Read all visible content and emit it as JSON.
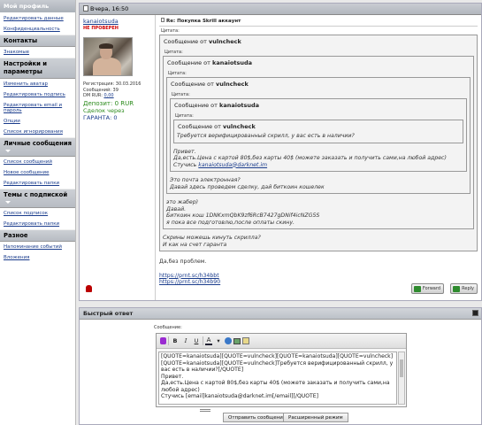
{
  "sidebar": {
    "top": "Мой профиль",
    "sections": [
      {
        "links": [
          "Редактировать данные",
          "Конфиденциальность"
        ]
      },
      {
        "title": "Контакты",
        "links": [
          "Знакомые"
        ]
      },
      {
        "title": "Настройки и параметры",
        "links": [
          "Изменить аватар",
          "Редактировать подпись",
          "Редактировать email и пароль",
          "Опции",
          "Список игнорирования"
        ]
      },
      {
        "title": "Личные сообщения",
        "dropdown": true,
        "links": [
          "Список сообщений",
          "Новое сообщение",
          "Редактировать папки"
        ]
      },
      {
        "title": "Темы с подпиской",
        "dropdown": true,
        "links": [
          "Список подписок",
          "Редактировать папки"
        ]
      },
      {
        "title": "Разное",
        "links": [
          "Напоминание событий",
          "Вложения"
        ]
      }
    ]
  },
  "post": {
    "date": "Вчера, 16:50",
    "user": {
      "name": "kanaiotsuda",
      "status": "НЕ ПРОВЕРЕН",
      "reg": "Регистрация: 30.03.2016",
      "messages": "Сообщений: 39",
      "dm_label": "DM RUR: ",
      "dm_value": "0,00",
      "deposit": "Депозит: 0 RUR",
      "deals": "Сделок через",
      "guarantee": "ГАРАНТА: 0"
    },
    "title": "Re: Покупка Skrill аккаунт",
    "quote_label": "Цитата:",
    "from_prefix": "Сообщение от ",
    "q1_author": "vulncheck",
    "q2_author": "kanaiotsuda",
    "q3_author": "vulncheck",
    "q4_author": "kanaiotsuda",
    "q5_author": "vulncheck",
    "q5_text": "Требуется верифицированный скрилл, у вас есть в наличии?",
    "q4_text1": "Привет.",
    "q4_text2": "Да,есть.Цена с картой 80$,без карты 40$ (можете заказать и получить сами,на любой адрес)",
    "q4_text3_prefix": "Стучись ",
    "q4_text3_link": "kanaiotsuda@darknet.im",
    "q3_text1": "Это почта электронная?",
    "q3_text2": "Давай здесь проведем сделку, дай биткоин кошелек",
    "q2_text1": "это жабер)",
    "q2_text2": "Давай.",
    "q2_text3": "Биткоин кош 1DNKxmQbK9zf6RcB7427gDNif4icNZG5S",
    "q2_text4": "я пока все подготовлю,после оплаты скину.",
    "q1_text1": "Скрины можешь кинуть скрилла?",
    "q1_text2": "И как на счет гаранта",
    "reply1": "Да,без проблем.",
    "link1": "https://prnt.sc/h34bbt",
    "link2": "https://prnt.sc/h34b90",
    "forward_label": "Forward",
    "reply_label": "Reply"
  },
  "quick_reply": {
    "title": "Быстрый ответ",
    "message_label": "Сообщение:",
    "text": "[QUOTE=kanaiotsuda][QUOTE=vulncheck][QUOTE=kanaiotsuda][QUOTE=vulncheck][QUOTE=kanaiotsuda][QUOTE=vulncheck]Требуется верифицированный скрилл, у вас есть в наличии?[/QUOTE]\nПривет.\nДа,есть.Цена с картой 80$,без карты 40$ (можете заказать и получить сами,на любой адрес)\nСтучись [email]kanaiotsuda@darknet.im[/email][/QUOTE]",
    "bold": "B",
    "italic": "I",
    "underline": "U",
    "color_letter": "A",
    "send_label": "Отправить сообщение",
    "advanced_label": "Расширенный режим"
  }
}
